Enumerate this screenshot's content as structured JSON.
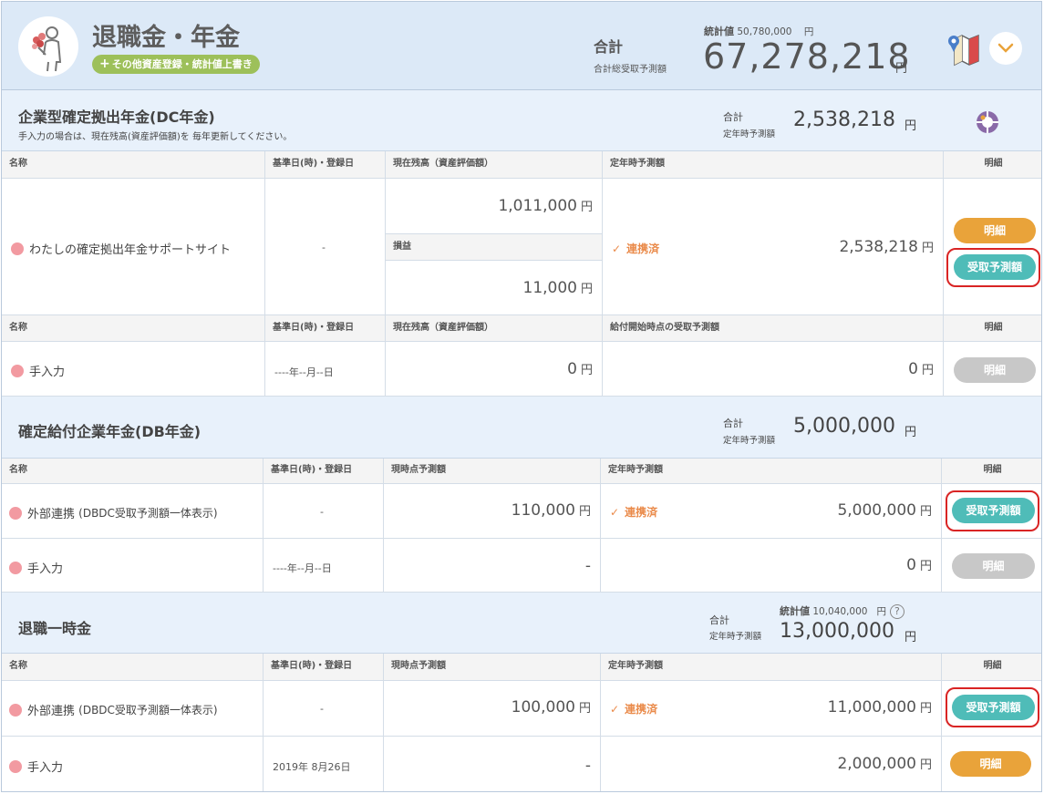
{
  "header": {
    "title": "退職金・年金",
    "add_pill": "その他資産登録・統計値上書き",
    "total_label": "合計",
    "total_sub": "合計総受取予測額",
    "stat_label": "統計値",
    "stat_value": "50,780,000",
    "stat_unit": "円",
    "total_value": "67,278,218",
    "total_unit": "円"
  },
  "dc": {
    "title": "企業型確定拠出年金(DC年金)",
    "note": "手入力の場合は、現在残高(資産評価額)を 毎年更新してください。",
    "sum_label": "合計",
    "sum_sub": "定年時予測額",
    "sum_value": "2,538,218",
    "sum_unit": "円",
    "headers": [
      "名称",
      "基準日(時)・登録日",
      "現在残高（資産評価額）",
      "定年時予測額",
      "明細"
    ],
    "row1": {
      "name": "わたしの確定拠出年金サポートサイト",
      "date": "-",
      "balance": "1,011,000",
      "profit_label": "損益",
      "profit": "11,000",
      "status": "連携済",
      "forecast": "2,538,218",
      "btn_detail": "明細",
      "btn_forecast": "受取予測額"
    },
    "headers2": [
      "名称",
      "基準日(時)・登録日",
      "現在残高（資産評価額）",
      "給付開始時点の受取予測額",
      "明細"
    ],
    "row2": {
      "name": "手入力",
      "date": "----年--月--日",
      "balance": "0",
      "forecast": "0",
      "btn_detail": "明細"
    }
  },
  "db": {
    "title": "確定給付企業年金(DB年金)",
    "sum_label": "合計",
    "sum_sub": "定年時予測額",
    "sum_value": "5,000,000",
    "sum_unit": "円",
    "headers": [
      "名称",
      "基準日(時)・登録日",
      "現時点予測額",
      "定年時予測額",
      "明細"
    ],
    "row1": {
      "name": "外部連携",
      "name_sub": "(DBDC受取予測額一体表示)",
      "date": "-",
      "current": "110,000",
      "status": "連携済",
      "forecast": "5,000,000",
      "btn_forecast": "受取予測額"
    },
    "row2": {
      "name": "手入力",
      "date": "----年--月--日",
      "current": "-",
      "forecast": "0",
      "btn_detail": "明細"
    }
  },
  "lump": {
    "title": "退職一時金",
    "sum_label": "合計",
    "sum_sub": "定年時予測額",
    "stat_label": "統計値",
    "stat_value": "10,040,000",
    "stat_unit": "円",
    "sum_value": "13,000,000",
    "sum_unit": "円",
    "headers": [
      "名称",
      "基準日(時)・登録日",
      "現時点予測額",
      "定年時予測額",
      "明細"
    ],
    "row1": {
      "name": "外部連携",
      "name_sub": "(DBDC受取予測額一体表示)",
      "date": "-",
      "current": "100,000",
      "status": "連携済",
      "forecast": "11,000,000",
      "btn_forecast": "受取予測額"
    },
    "row2": {
      "name": "手入力",
      "date": "2019年 8月26日",
      "current": "-",
      "forecast": "2,000,000",
      "btn_detail": "明細"
    }
  },
  "yen": "円",
  "qmark": "?",
  "colors": {
    "header_bg": "#dce9f7",
    "accent_orange": "#e9a33a",
    "accent_teal": "#4fbcb8",
    "disabled_gray": "#c8c8c8",
    "linked_orange": "#ea8b4b",
    "dot_pink": "#f29aa1",
    "highlight_red": "#d92424"
  }
}
